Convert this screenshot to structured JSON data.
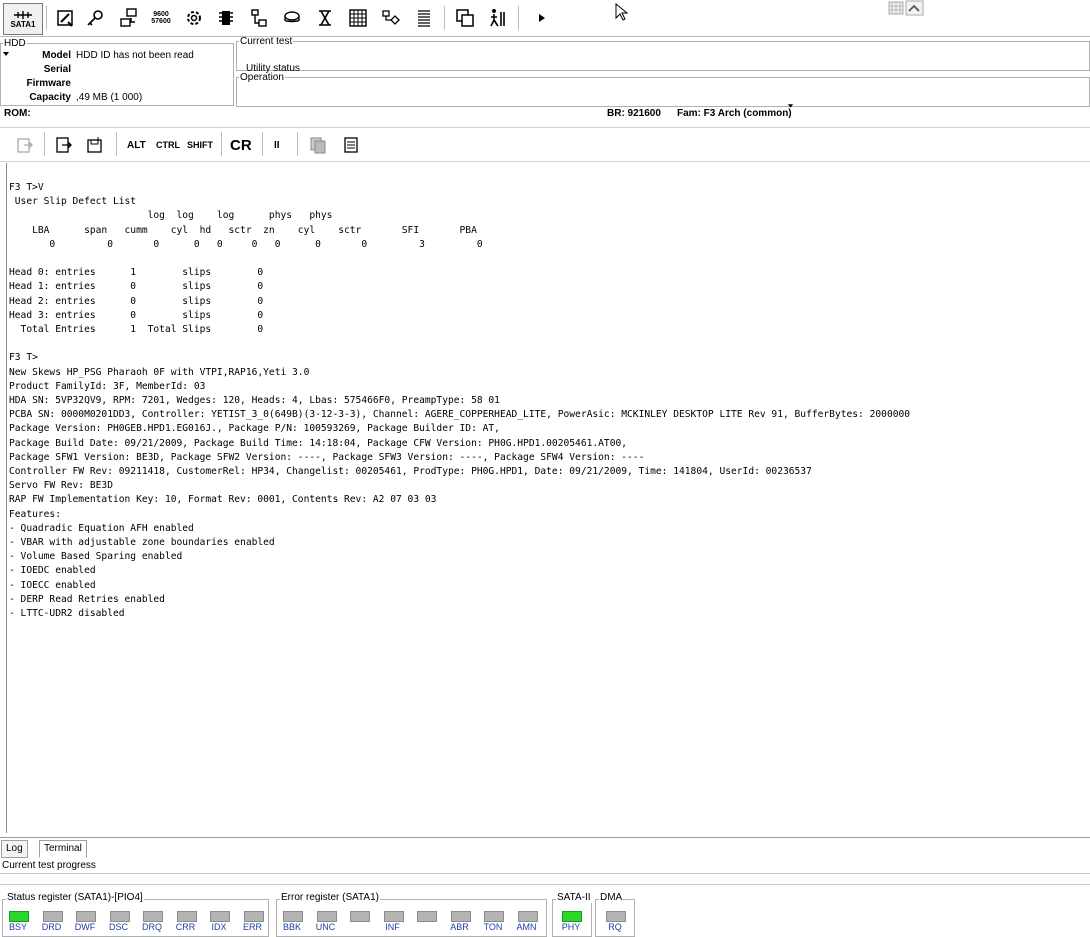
{
  "toolbar": {
    "sata_label": "SATA1",
    "buttons": [
      "tools-icon",
      "key-icon",
      "network-icon",
      "baud-icon",
      "gear-icon",
      "chip-icon",
      "hierarchy-icon",
      "disk-icon",
      "hourglass-icon",
      "grid-icon",
      "flowchart-icon",
      "list-icon",
      "windows-icon",
      "walk-icon",
      "play-icon"
    ],
    "baud_text": "9600 57600"
  },
  "hdd": {
    "legend": "HDD",
    "fields": [
      {
        "label": "Model",
        "value": "HDD ID has not been read"
      },
      {
        "label": "Serial",
        "value": ""
      },
      {
        "label": "Firmware",
        "value": ""
      },
      {
        "label": "Capacity",
        "value": ",49 MB (1 000)"
      }
    ]
  },
  "current_test": {
    "legend": "Current test",
    "value": "Utility status"
  },
  "operation": {
    "legend": "Operation",
    "value": ""
  },
  "status": {
    "rom": "ROM:",
    "br": "BR: 921600",
    "fam": "Fam: F3 Arch (common)"
  },
  "toolbar2": {
    "alt": "ALT",
    "ctrl": "CTRL",
    "shift": "SHIFT",
    "cr": "CR",
    "pause": "II"
  },
  "terminal": {
    "lines": [
      "F3 T>V",
      " User Slip Defect List",
      "                        log  log    log      phys   phys",
      "    LBA      span   cumm    cyl  hd   sctr  zn    cyl    sctr       SFI       PBA",
      "       0         0       0      0   0     0   0      0       0         3         0",
      "",
      "Head 0: entries      1        slips        0",
      "Head 1: entries      0        slips        0",
      "Head 2: entries      0        slips        0",
      "Head 3: entries      0        slips        0",
      "  Total Entries      1  Total Slips        0",
      "",
      "F3 T>",
      "New Skews HP_PSG Pharaoh 0F with VTPI,RAP16,Yeti 3.0",
      "Product FamilyId: 3F, MemberId: 03",
      "HDA SN: 5VP32QV9, RPM: 7201, Wedges: 120, Heads: 4, Lbas: 575466F0, PreampType: 58 01",
      "PCBA SN: 0000M0201DD3, Controller: YETIST_3_0(649B)(3-12-3-3), Channel: AGERE_COPPERHEAD_LITE, PowerAsic: MCKINLEY DESKTOP LITE Rev 91, BufferBytes: 2000000",
      "Package Version: PH0GEB.HPD1.EG016J., Package P/N: 100593269, Package Builder ID: AT,",
      "Package Build Date: 09/21/2009, Package Build Time: 14:18:04, Package CFW Version: PH0G.HPD1.00205461.AT00,",
      "Package SFW1 Version: BE3D, Package SFW2 Version: ----, Package SFW3 Version: ----, Package SFW4 Version: ----",
      "Controller FW Rev: 09211418, CustomerRel: HP34, Changelist: 00205461, ProdType: PH0G.HPD1, Date: 09/21/2009, Time: 141804, UserId: 00236537",
      "Servo FW Rev: BE3D",
      "RAP FW Implementation Key: 10, Format Rev: 0001, Contents Rev: A2 07 03 03",
      "Features:",
      "- Quadradic Equation AFH enabled",
      "- VBAR with adjustable zone boundaries enabled",
      "- Volume Based Sparing enabled",
      "- IOEDC enabled",
      "- IOECC enabled",
      "- DERP Read Retries enabled",
      "- LTTC-UDR2 disabled"
    ]
  },
  "tabs": {
    "log": "Log",
    "terminal": "Terminal"
  },
  "progress": {
    "label": "Current test progress"
  },
  "status_register": {
    "title": "Status register (SATA1)-[PIO4]",
    "leds": [
      {
        "label": "BSY",
        "on": true
      },
      {
        "label": "DRD",
        "on": false
      },
      {
        "label": "DWF",
        "on": false
      },
      {
        "label": "DSC",
        "on": false
      },
      {
        "label": "DRQ",
        "on": false
      },
      {
        "label": "CRR",
        "on": false
      },
      {
        "label": "IDX",
        "on": false
      },
      {
        "label": "ERR",
        "on": false
      }
    ]
  },
  "error_register": {
    "title": "Error register (SATA1)",
    "leds": [
      {
        "label": "BBK",
        "on": false
      },
      {
        "label": "UNC",
        "on": false
      },
      {
        "label": "",
        "on": false
      },
      {
        "label": "INF",
        "on": false
      },
      {
        "label": "",
        "on": false
      },
      {
        "label": "ABR",
        "on": false
      },
      {
        "label": "TON",
        "on": false
      },
      {
        "label": "AMN",
        "on": false
      }
    ]
  },
  "sata_ii": {
    "title": "SATA-II",
    "leds": [
      {
        "label": "PHY",
        "on": true
      }
    ]
  },
  "dma": {
    "title": "DMA",
    "leds": [
      {
        "label": "RQ",
        "on": false
      }
    ]
  }
}
